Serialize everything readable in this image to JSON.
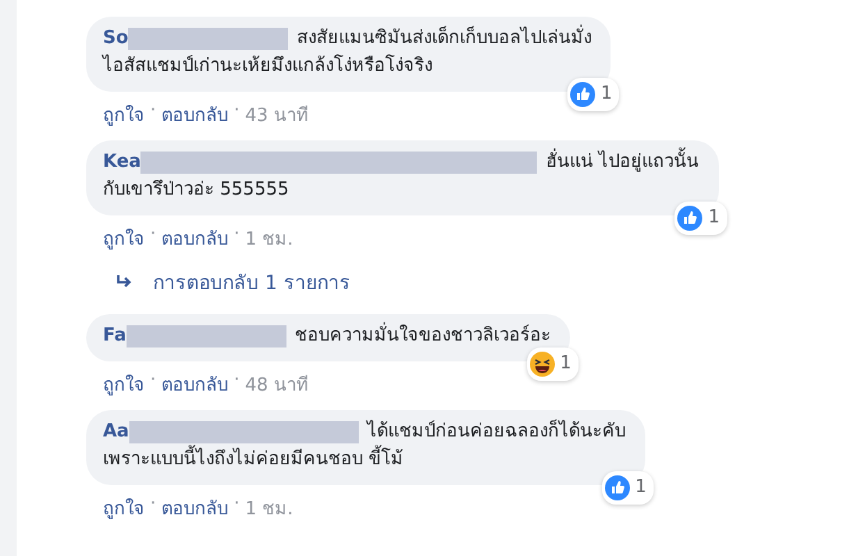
{
  "comments": [
    {
      "name": "So",
      "lines": [
        "สงสัยแมนซิมันส่งเด็กเก็บบอลไปเล่นมั่ง",
        "ไอสัสแชมป์เก่านะเห้ยมึงแกล้งโง่หรือโง่จริง"
      ],
      "reaction": {
        "kind": "like",
        "count": "1"
      },
      "like": "ถูกใจ",
      "sep1": "·",
      "reply": "ตอบกลับ",
      "sep2": "·",
      "time": "43 นาที"
    },
    {
      "name": "Kea",
      "lines": [
        "ฮั่นแน่ ไปอยู่แถวนั้น",
        "กับเขารึป่าวอ่ะ 555555"
      ],
      "reaction": {
        "kind": "like",
        "count": "1"
      },
      "like": "ถูกใจ",
      "sep1": "·",
      "reply": "ตอบกลับ",
      "sep2": "·",
      "time": "1 ชม.",
      "replies_link": "การตอบกลับ 1 รายการ"
    },
    {
      "name": "Fa",
      "lines": [
        "ชอบความมั่นใจของชาวลิเวอร์อะ"
      ],
      "reaction": {
        "kind": "haha",
        "count": "1"
      },
      "like": "ถูกใจ",
      "sep1": "·",
      "reply": "ตอบกลับ",
      "sep2": "·",
      "time": "48 นาที"
    },
    {
      "name": "Aa",
      "lines": [
        "ได้แชมป์ก่อนค่อยฉลองก็ได้นะคับ",
        "เพราะแบบนี้ไงถึงไม่ค่อยมีคนชอบ ขี้โม้"
      ],
      "reaction": {
        "kind": "like",
        "count": "1"
      },
      "like": "ถูกใจ",
      "sep1": "·",
      "reply": "ตอบกลับ",
      "sep2": "·",
      "time": "1 ชม."
    }
  ]
}
